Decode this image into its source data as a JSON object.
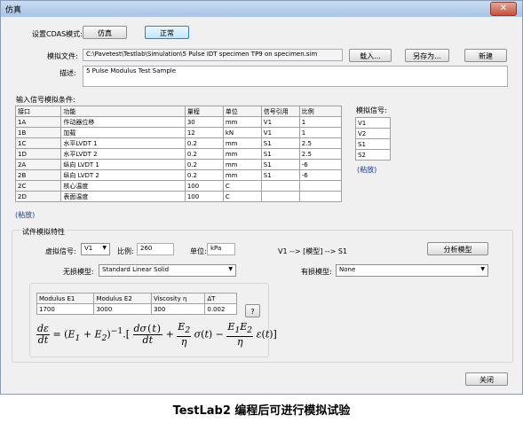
{
  "window": {
    "title": "仿真",
    "close_label": "✕"
  },
  "mode": {
    "label": "设置CDAS模式:",
    "sim_button": "仿真",
    "normal_button": "正常"
  },
  "file": {
    "label": "模拟文件:",
    "path": "C:\\Pavetest\\Testlab\\Simulation\\5 Pulse IDT specimen TP9 on specimen.sim",
    "load_button": "载入...",
    "save_as_button": "另存为...",
    "new_button": "新建"
  },
  "description": {
    "label": "描述:",
    "value": "5 Pulse Modulus Test Sample"
  },
  "inputs": {
    "section_label": "输入信号模拟条件:",
    "headers": [
      "接口",
      "功能",
      "量程",
      "单位",
      "信号引用",
      "比例"
    ],
    "rows": [
      [
        "1A",
        "作动器位移",
        "30",
        "mm",
        "V1",
        "1"
      ],
      [
        "1B",
        "加载",
        "12",
        "kN",
        "V1",
        "1"
      ],
      [
        "1C",
        "水平LVDT 1",
        "0.2",
        "mm",
        "S1",
        "2.5"
      ],
      [
        "1D",
        "水平LVDT 2",
        "0.2",
        "mm",
        "S1",
        "2.5"
      ],
      [
        "2A",
        "纵向 LVDT 1",
        "0.2",
        "mm",
        "S1",
        "-6"
      ],
      [
        "2B",
        "纵向 LVDT 2",
        "0.2",
        "mm",
        "S1",
        "-6"
      ],
      [
        "2C",
        "核心温度",
        "100",
        "C",
        "",
        ""
      ],
      [
        "2D",
        "表面温度",
        "100",
        "C",
        "",
        ""
      ]
    ],
    "edit_link": "(粘放)"
  },
  "signals": {
    "label": "模拟信号:",
    "items": [
      "V1",
      "V2",
      "S1",
      "S2"
    ],
    "edit_link": "(粘放)"
  },
  "specimen": {
    "section_label": "试件模拟特性",
    "signal_label": "虚拟信号:",
    "signal_value": "V1",
    "ratio_label": "比例:",
    "ratio_value": "260",
    "unit_label": "单位:",
    "unit_value": "kPa",
    "mapping_text": "V1 --> [模型] --> S1",
    "analyze_button": "分析模型",
    "lossless_label": "无损模型:",
    "lossless_value": "Standard Linear Solid",
    "lossy_label": "有损模型:",
    "lossy_value": "None",
    "param_headers": [
      "Modulus E1",
      "Modulus E2",
      "Viscosity η",
      "ΔT"
    ],
    "param_values": [
      "1700",
      "3000",
      "300",
      "0.002"
    ],
    "help_button": "?"
  },
  "close_button": "关闭",
  "caption": "TestLab2 编程后可进行模拟试验"
}
